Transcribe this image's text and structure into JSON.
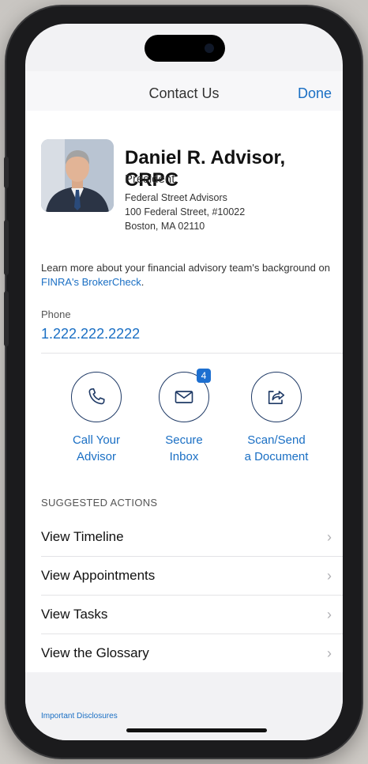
{
  "header": {
    "title": "Contact Us",
    "done_label": "Done"
  },
  "advisor": {
    "name": "Daniel R. Advisor, CRPC",
    "title": "President",
    "firm": "Federal Street Advisors",
    "address_line1": "100 Federal Street, #10022",
    "address_line2": "Boston, MA 02110"
  },
  "learn_more": {
    "text": "Learn more about your financial advisory team's background on ",
    "link": "FINRA's BrokerCheck",
    "suffix": "."
  },
  "phone": {
    "label": "Phone",
    "number": "1.222.222.2222"
  },
  "actions": [
    {
      "line1": "Call Your",
      "line2": "Advisor",
      "icon": "phone-icon"
    },
    {
      "line1": "Secure",
      "line2": "Inbox",
      "icon": "envelope-icon",
      "badge": "4"
    },
    {
      "line1": "Scan/Send",
      "line2": "a Document",
      "icon": "share-icon"
    }
  ],
  "suggested": {
    "heading": "SUGGESTED ACTIONS",
    "items": [
      "View Timeline",
      "View Appointments",
      "View Tasks",
      "View the Glossary"
    ]
  },
  "footer": {
    "disclosures": "Important Disclosures"
  },
  "colors": {
    "accent": "#1a6fc4",
    "badge": "#1d6fd0",
    "icon_stroke": "#1f3a66"
  }
}
